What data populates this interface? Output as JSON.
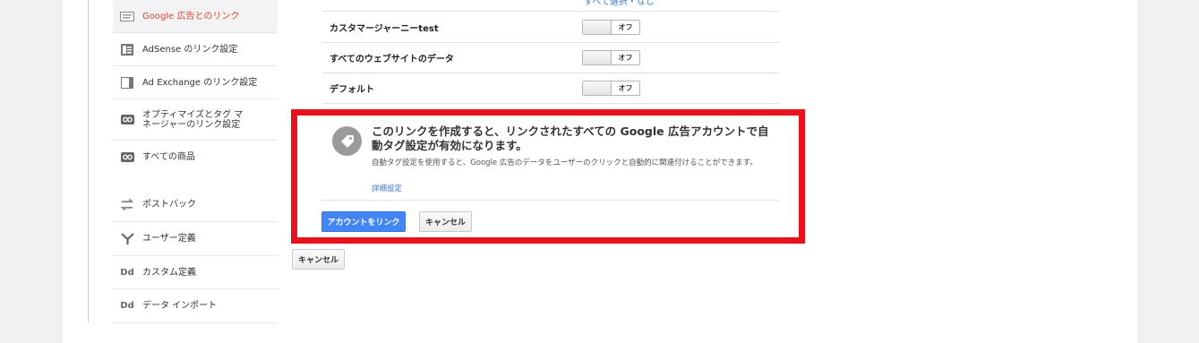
{
  "sidebar": {
    "items": [
      {
        "label": "Google 広告とのリンク",
        "icon": "ad-banner-icon"
      },
      {
        "label": "AdSense のリンク設定",
        "icon": "adsense-icon"
      },
      {
        "label": "Ad Exchange のリンク設定",
        "icon": "ad-exchange-icon"
      },
      {
        "label": "オプティマイズとタグ マネージャーのリンク設定",
        "icon": "link-icon"
      },
      {
        "label": "すべての商品",
        "icon": "link-icon"
      },
      {
        "label": "ポストバック",
        "icon": "postback-icon"
      },
      {
        "label": "ユーザー定義",
        "icon": "user-definition-icon"
      },
      {
        "label": "カスタム定義",
        "icon": "dd-icon",
        "icon_text": "Dd"
      },
      {
        "label": "データ インポート",
        "icon": "dd-icon",
        "icon_text": "Dd"
      }
    ]
  },
  "table": {
    "toplink": "すべて選択・なし",
    "rows": [
      {
        "name": "カスタマージャーニーtest",
        "state": "オフ"
      },
      {
        "name": "すべてのウェブサイトのデータ",
        "state": "オフ"
      },
      {
        "name": "デフォルト",
        "state": "オフ"
      }
    ]
  },
  "callout": {
    "title": "このリンクを作成すると、リンクされたすべての Google 広告アカウントで自動タグ設定が有効になります。",
    "description": "自動タグ設定を使用すると、Google 広告のデータをユーザーのクリックと自動的に関連付けることができます。",
    "more_link": "詳細設定",
    "link_button": "アカウントをリンク",
    "cancel_button": "キャンセル"
  },
  "footer": {
    "cancel_button": "キャンセル"
  },
  "colors": {
    "highlight_border": "#e8121d",
    "primary_button": "#4285f4",
    "active_sidebar_text": "#d9463a",
    "link": "#3a7bd5"
  }
}
